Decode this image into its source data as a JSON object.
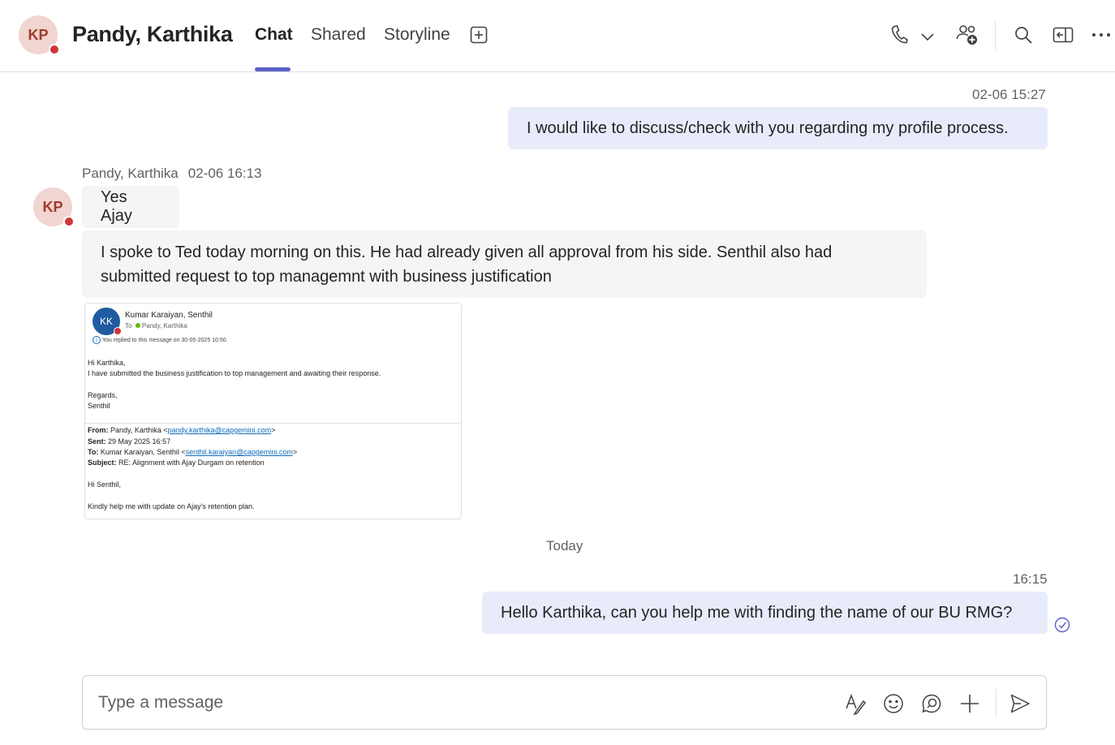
{
  "header": {
    "avatar_initials": "KP",
    "contact_name": "Pandy, Karthika",
    "tabs": [
      {
        "label": "Chat",
        "active": true
      },
      {
        "label": "Shared",
        "active": false
      },
      {
        "label": "Storyline",
        "active": false
      }
    ],
    "icons": [
      "add-tab-icon",
      "phone-icon",
      "chevron-down-icon",
      "add-people-icon",
      "search-icon",
      "pop-out-icon",
      "more-options-icon"
    ]
  },
  "messages": {
    "m1": {
      "time": "02-06 15:27",
      "text": "I would like to discuss/check with you regarding my profile process."
    },
    "m2": {
      "sender": "Pandy, Karthika",
      "time": "02-06 16:13",
      "avatar_initials": "KP",
      "text1": "Yes Ajay",
      "text2_line1": "I spoke to Ted today morning on this. He had already given all approval from his side. Senthil also had",
      "text2_line2": "submitted request to top managemnt with business justification"
    },
    "email": {
      "avatar_initials": "KK",
      "from_name": "Kumar Karaiyan, Senthil",
      "to_prefix": "To",
      "to_name": "Pandy, Karthika",
      "replied_note": "You replied to this message on 30-05-2025 10:50.",
      "greeting": "Hi Karthika,",
      "body": "I have submitted the business justification to top management and awaiting their response.",
      "regards": "Regards,",
      "signoff": "Senthil",
      "q_from_label": "From:",
      "q_from_name": "Pandy, Karthika <",
      "q_from_email": "pandy.karthika@capgemini.com",
      "q_close": ">",
      "q_sent_label": "Sent:",
      "q_sent": "29 May 2025 16:57",
      "q_to_label": "To:",
      "q_to_name": "Kumar Karaiyan, Senthil <",
      "q_to_email": "senthil.karaiyan@capgemini.com",
      "q_subject_label": "Subject:",
      "q_subject": "RE: Alignment with Ajay Durgam on retention",
      "q_greeting": "Hi Senthil,",
      "q_body": "Kindly help me with update on Ajay’s retention plan."
    },
    "divider_label": "Today",
    "m3": {
      "time": "16:15",
      "text": "Hello Karthika, can you help me with finding the name of our BU RMG?",
      "status_icon": "read-receipt-check-icon"
    }
  },
  "compose": {
    "placeholder": "Type a message",
    "icons": [
      "format-icon",
      "emoji-icon",
      "loop-icon",
      "attach-plus-icon",
      "send-icon"
    ]
  },
  "colors": {
    "accent": "#5b5fc7",
    "my_bubble": "#e8ebfa",
    "their_bubble": "#f5f5f5",
    "avatar_bg": "#f1d5d0",
    "presence_busy": "#d13438"
  }
}
